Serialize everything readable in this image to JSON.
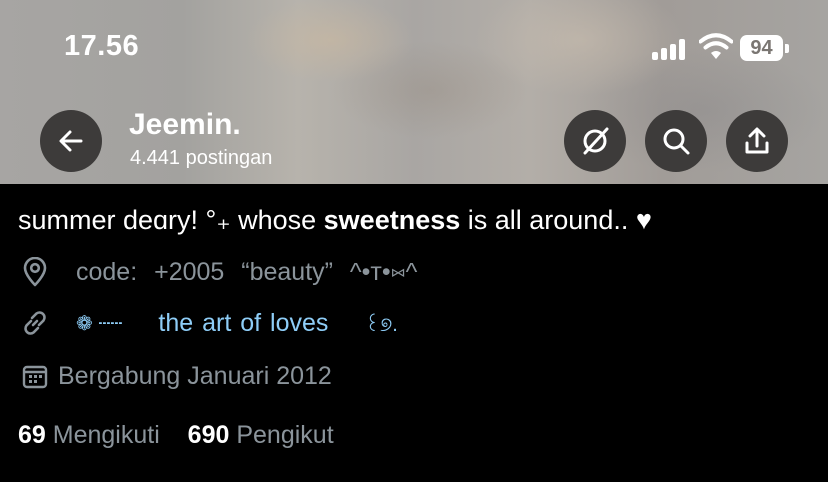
{
  "status_bar": {
    "time": "17.56",
    "battery": "94"
  },
  "profile_header": {
    "name": "Jeemin.",
    "post_count": "4.441 postingan"
  },
  "bio": {
    "part1": "summer deɑry! °₊ whose ",
    "bold": "sweetness",
    "part2": " is all around.. ♥"
  },
  "location": "code:  +2005  “beauty”   ^•ᴛ•⑅^",
  "website": {
    "decor_left": "❁ ┄┄",
    "text": "the  art  of  loves",
    "decor_right": "꒰୭."
  },
  "joined": "Bergabung Januari 2012",
  "stats": {
    "following_count": "69",
    "following_label": "Mengikuti",
    "followers_count": "690",
    "followers_label": "Pengikut"
  },
  "icons": [
    "back-arrow-icon",
    "grok-icon",
    "search-icon",
    "share-icon",
    "location-pin-icon",
    "link-icon",
    "calendar-icon",
    "signal-icon",
    "wifi-icon",
    "battery-icon"
  ]
}
